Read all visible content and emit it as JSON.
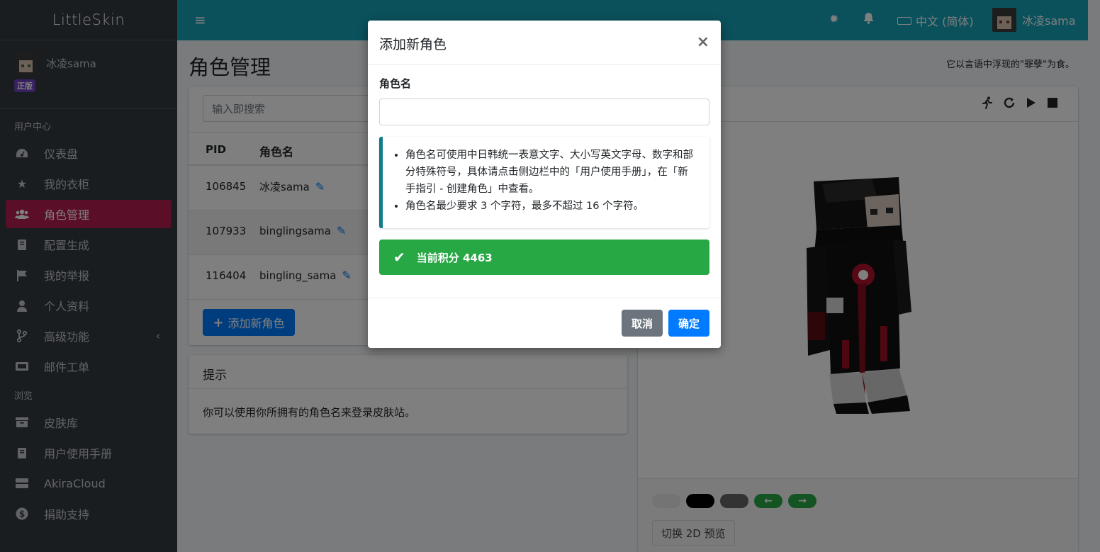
{
  "brand": "LittleSkin",
  "user": {
    "name": "冰凌sama",
    "badge": "正版"
  },
  "sidebar": {
    "header_user": "用户中心",
    "header_browse": "浏览",
    "items": [
      {
        "label": "仪表盘",
        "icon": "dashboard-icon"
      },
      {
        "label": "我的衣柜",
        "icon": "star-icon"
      },
      {
        "label": "角色管理",
        "icon": "users-icon",
        "active": true
      },
      {
        "label": "配置生成",
        "icon": "book-icon"
      },
      {
        "label": "我的举报",
        "icon": "flag-icon"
      },
      {
        "label": "个人资料",
        "icon": "user-icon"
      },
      {
        "label": "高级功能",
        "icon": "branch-icon"
      },
      {
        "label": "邮件工单",
        "icon": "envelope-icon"
      }
    ],
    "browse_items": [
      {
        "label": "皮肤库",
        "icon": "archive-icon"
      },
      {
        "label": "用户使用手册",
        "icon": "book-icon"
      },
      {
        "label": "AkiraCloud",
        "icon": "server-icon"
      },
      {
        "label": "捐助支持",
        "icon": "dollar-icon"
      }
    ]
  },
  "topbar": {
    "language": "中文 (简体)",
    "user_name": "冰凌sama"
  },
  "page": {
    "title": "角色管理",
    "quote": "它以言语中浮现的\"罪孽\"为食。"
  },
  "players": {
    "search_placeholder": "输入即搜索",
    "col_pid": "PID",
    "col_name": "角色名",
    "rows": [
      {
        "pid": "106845",
        "name": "冰凌sama"
      },
      {
        "pid": "107933",
        "name": "binglingsama"
      },
      {
        "pid": "116404",
        "name": "bingling_sama"
      }
    ],
    "add_button": "添加新角色"
  },
  "tips": {
    "title": "提示",
    "body": "你可以使用你所拥有的角色名来登录皮肤站。"
  },
  "preview": {
    "toggle_2d": "切换 2D 预览"
  },
  "modal": {
    "title": "添加新角色",
    "field_label": "角色名",
    "input_value": "",
    "rule1": "角色名可使用中日韩统一表意文字、大小写英文字母、数字和部分特殊符号，具体请点击侧边栏中的「用户使用手册」，在「新手指引 - 创建角色」中查看。",
    "rule2": "角色名最少要求 3 个字符，最多不超过 16 个字符。",
    "credits": "当前积分 4463",
    "cancel": "取消",
    "confirm": "确定"
  },
  "colors": {
    "sidebar_bg": "#343a40",
    "topbar_bg": "#17a2b8",
    "active_item": "#b71c4f",
    "primary": "#007bff",
    "success": "#28a745",
    "secondary": "#6c757d"
  }
}
